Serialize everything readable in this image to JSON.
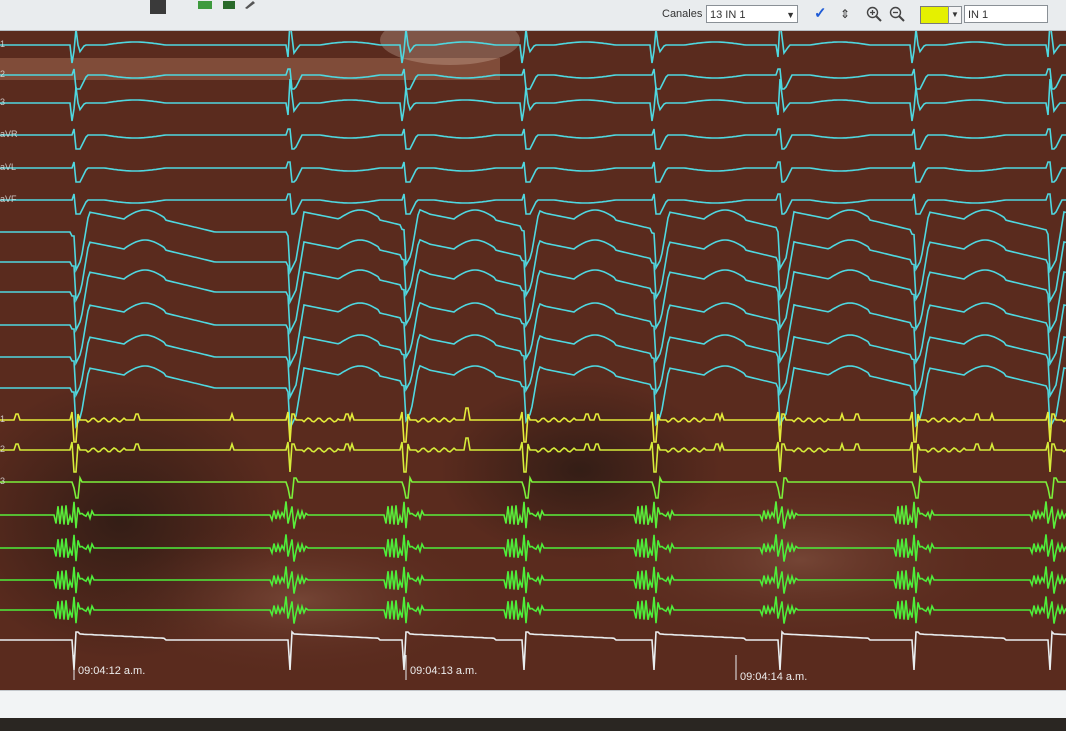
{
  "toolbar": {
    "canales_label": "Canales",
    "canales_value": "13 IN 1",
    "channel_field": "IN 1",
    "highlight_color": "#e5f000",
    "icons": [
      "save-icon",
      "print-icon",
      "edit-icon",
      "check-icon",
      "up-down-icon",
      "zoom-in-icon",
      "zoom-out-icon",
      "dropdown-arrow-icon"
    ]
  },
  "channels": [
    {
      "label": "1",
      "color": "#4fd8e0"
    },
    {
      "label": "2",
      "color": "#4fd8e0"
    },
    {
      "label": "3",
      "color": "#4fd8e0"
    },
    {
      "label": "aVR",
      "color": "#4fd8e0"
    },
    {
      "label": "aVL",
      "color": "#4fd8e0"
    },
    {
      "label": "aVF",
      "color": "#4fd8e0"
    },
    {
      "label": "",
      "color": "#4fd8e0"
    },
    {
      "label": "",
      "color": "#4fd8e0"
    },
    {
      "label": "",
      "color": "#4fd8e0"
    },
    {
      "label": "",
      "color": "#4fd8e0"
    },
    {
      "label": "",
      "color": "#4fd8e0"
    },
    {
      "label": "",
      "color": "#4fd8e0"
    },
    {
      "label": "1",
      "color": "#e4ec3a"
    },
    {
      "label": "2",
      "color": "#d6ec3a"
    },
    {
      "label": "3",
      "color": "#7cf03a"
    },
    {
      "label": "",
      "color": "#5aee3a"
    },
    {
      "label": "",
      "color": "#4eee3a"
    },
    {
      "label": "",
      "color": "#4eee3a"
    },
    {
      "label": "",
      "color": "#4eee3a"
    },
    {
      "label": "",
      "color": "#eaeef0"
    }
  ],
  "timestamps": [
    "09:04:12 a.m.",
    "09:04:13 a.m.",
    "09:04:14 a.m."
  ],
  "beats": [
    75,
    290,
    405,
    525,
    655,
    780,
    915,
    1050
  ]
}
